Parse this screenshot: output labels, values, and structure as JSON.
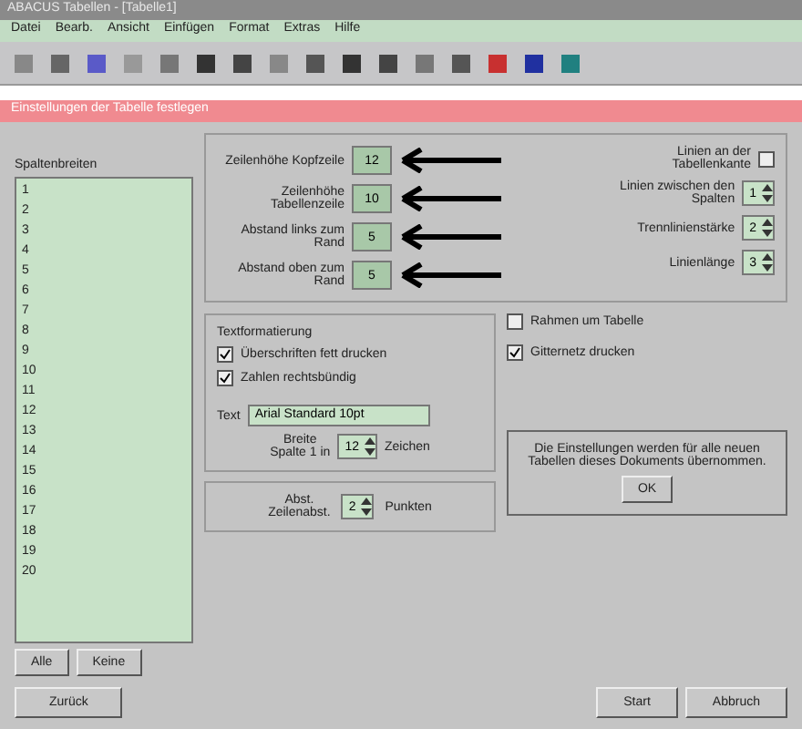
{
  "app_title": "ABACUS Tabellen - [Tabelle1]",
  "menu": [
    "Datei",
    "Bearb.",
    "Ansicht",
    "Einfügen",
    "Format",
    "Extras",
    "Hilfe"
  ],
  "dialog_title": "Einstellungen der Tabelle festlegen",
  "list": {
    "label": "Spaltenbreiten",
    "items": [
      "1",
      "2",
      "3",
      "4",
      "5",
      "6",
      "7",
      "8",
      "9",
      "10",
      "11",
      "12",
      "13",
      "14",
      "15",
      "16",
      "17",
      "18",
      "19",
      "20"
    ],
    "buttons": [
      "Alle",
      "Keine"
    ]
  },
  "fields": [
    {
      "label": "Zeilenhöhe Kopfzeile",
      "value": "12"
    },
    {
      "label": "Zeilenhöhe Tabellenzeile",
      "value": "10"
    },
    {
      "label": "Abstand links zum Rand",
      "value": "5"
    },
    {
      "label": "Abstand oben zum Rand",
      "value": "5"
    }
  ],
  "options": [
    {
      "label": "Linien an der Tabellenkante",
      "kind": "checkbox",
      "checked": false
    },
    {
      "label": "Linien zwischen den Spalten",
      "kind": "spin",
      "value": "1"
    },
    {
      "label": "Trennlinienstärke",
      "kind": "spin",
      "value": "2"
    },
    {
      "label": "Linienlänge",
      "kind": "spin",
      "value": "3"
    }
  ],
  "format_group": {
    "title": "Textformatierung",
    "checks": [
      {
        "label": "Überschriften fett drucken",
        "checked": true
      },
      {
        "label": "Zahlen rechtsbündig",
        "checked": true
      }
    ],
    "text_label": "Text",
    "text_value": "Arial Standard 10pt",
    "spin_top": "Breite",
    "spin_label": "Spalte 1 in",
    "spin_value": "12",
    "spin_unit": "Zeichen"
  },
  "spacing": {
    "top": "Abst.",
    "label": "Zeilenabst.",
    "value": "2",
    "unit": "Punkten"
  },
  "right_checks": [
    {
      "label": "Rahmen um Tabelle",
      "checked": false
    },
    {
      "label": "Gitternetz drucken",
      "checked": true
    }
  ],
  "info": {
    "text": "Die Einstellungen werden für alle neuen Tabellen dieses Dokuments übernommen.",
    "button": "OK"
  },
  "bottom": {
    "left": "Zurück",
    "buttons": [
      "Start",
      "Abbruch"
    ]
  }
}
